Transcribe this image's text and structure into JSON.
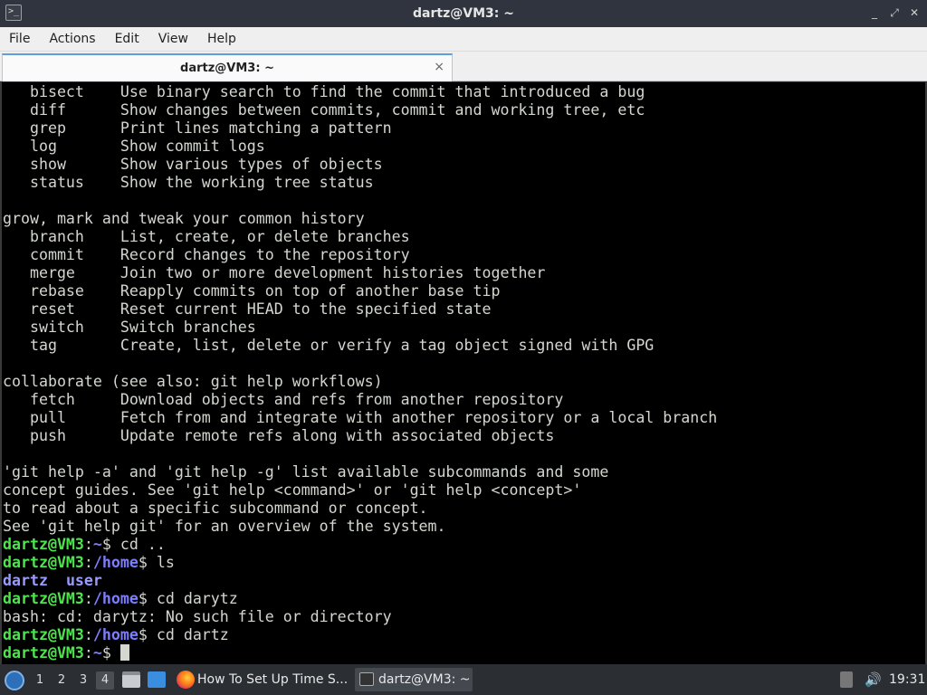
{
  "window": {
    "title": "dartz@VM3: ~",
    "controls": [
      "_",
      "⤢",
      "✕"
    ]
  },
  "menu": [
    "File",
    "Actions",
    "Edit",
    "View",
    "Help"
  ],
  "tab": {
    "label": "dartz@VM3: ~",
    "close": "×"
  },
  "terminal": {
    "lines": [
      {
        "t": "   bisect    Use binary search to find the commit that introduced a bug"
      },
      {
        "t": "   diff      Show changes between commits, commit and working tree, etc"
      },
      {
        "t": "   grep      Print lines matching a pattern"
      },
      {
        "t": "   log       Show commit logs"
      },
      {
        "t": "   show      Show various types of objects"
      },
      {
        "t": "   status    Show the working tree status"
      },
      {
        "t": ""
      },
      {
        "t": "grow, mark and tweak your common history"
      },
      {
        "t": "   branch    List, create, or delete branches"
      },
      {
        "t": "   commit    Record changes to the repository"
      },
      {
        "t": "   merge     Join two or more development histories together"
      },
      {
        "t": "   rebase    Reapply commits on top of another base tip"
      },
      {
        "t": "   reset     Reset current HEAD to the specified state"
      },
      {
        "t": "   switch    Switch branches"
      },
      {
        "t": "   tag       Create, list, delete or verify a tag object signed with GPG"
      },
      {
        "t": ""
      },
      {
        "t": "collaborate (see also: git help workflows)"
      },
      {
        "t": "   fetch     Download objects and refs from another repository"
      },
      {
        "t": "   pull      Fetch from and integrate with another repository or a local branch"
      },
      {
        "t": "   push      Update remote refs along with associated objects"
      },
      {
        "t": ""
      },
      {
        "t": "'git help -a' and 'git help -g' list available subcommands and some"
      },
      {
        "t": "concept guides. See 'git help <command>' or 'git help <concept>'"
      },
      {
        "t": "to read about a specific subcommand or concept."
      },
      {
        "t": "See 'git help git' for an overview of the system."
      },
      {
        "prompt": {
          "user": "dartz@VM3",
          "path": "~",
          "cmd": " cd .."
        }
      },
      {
        "prompt": {
          "user": "dartz@VM3",
          "path": "/home",
          "cmd": " ls"
        }
      },
      {
        "dirs": [
          "dartz",
          "user"
        ]
      },
      {
        "prompt": {
          "user": "dartz@VM3",
          "path": "/home",
          "cmd": " cd darytz"
        }
      },
      {
        "t": "bash: cd: darytz: No such file or directory"
      },
      {
        "prompt": {
          "user": "dartz@VM3",
          "path": "/home",
          "cmd": " cd dartz"
        }
      },
      {
        "prompt": {
          "user": "dartz@VM3",
          "path": "~",
          "cmd": " "
        },
        "cursor": true
      }
    ]
  },
  "taskbar": {
    "workspaces": [
      "1",
      "2",
      "3",
      "4"
    ],
    "active_workspace": "4",
    "tasks": [
      {
        "label": "How To Set Up Time S..."
      },
      {
        "label": "dartz@VM3: ~"
      }
    ],
    "clock": "19:31"
  },
  "colors": {
    "prompt_user": "#4ee44e",
    "prompt_path": "#7d7dff",
    "terminal_bg": "#000000",
    "terminal_fg": "#d3d7cf"
  }
}
